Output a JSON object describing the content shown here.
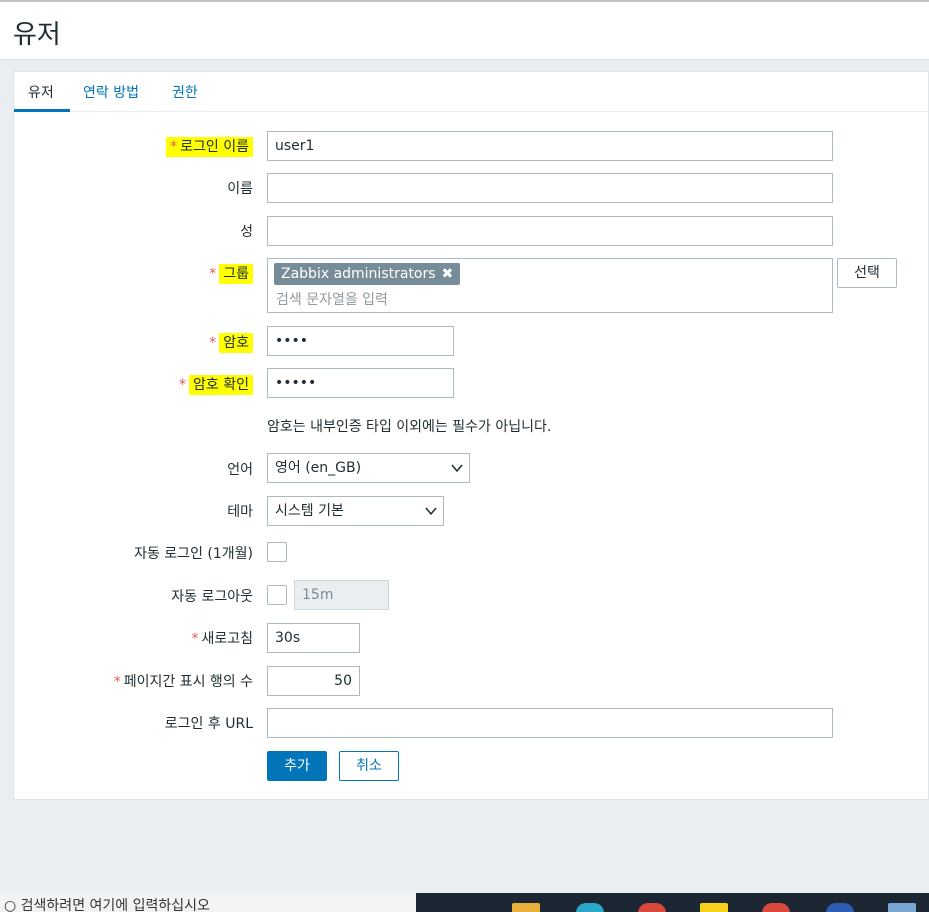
{
  "page": {
    "title": "유저"
  },
  "tabs": [
    {
      "label": "유저",
      "active": true
    },
    {
      "label": "연락 방법",
      "active": false
    },
    {
      "label": "권한",
      "active": false
    }
  ],
  "form": {
    "login": {
      "label": "로그인 이름",
      "value": "user1",
      "required": true
    },
    "name": {
      "label": "이름",
      "value": ""
    },
    "surname": {
      "label": "성",
      "value": ""
    },
    "groups": {
      "label": "그룹",
      "required": true,
      "chip": "Zabbix administrators",
      "placeholder": "검색 문자열을 입력",
      "select_button": "선택"
    },
    "password": {
      "label": "암호",
      "value": "••••",
      "required": true
    },
    "password_confirm": {
      "label": "암호 확인",
      "value": "•••••",
      "required": true
    },
    "password_hint": "암호는 내부인증 타입 이외에는 필수가 아닙니다.",
    "language": {
      "label": "언어",
      "value": "영어 (en_GB)"
    },
    "theme": {
      "label": "테마",
      "value": "시스템 기본"
    },
    "autologin": {
      "label": "자동 로그인 (1개월)",
      "checked": false
    },
    "autologout": {
      "label": "자동 로그아웃",
      "checked": false,
      "value": "15m"
    },
    "refresh": {
      "label": "새로고침",
      "value": "30s",
      "required": true
    },
    "rows_per_page": {
      "label": "페이지간 표시 행의 수",
      "value": "50",
      "required": true
    },
    "url": {
      "label": "로그인 후 URL",
      "value": ""
    },
    "add_button": "추가",
    "cancel_button": "취소"
  },
  "required_marker": "*",
  "taskbar": {
    "search_text": "검색하려면 여기에 입력하십시오"
  }
}
